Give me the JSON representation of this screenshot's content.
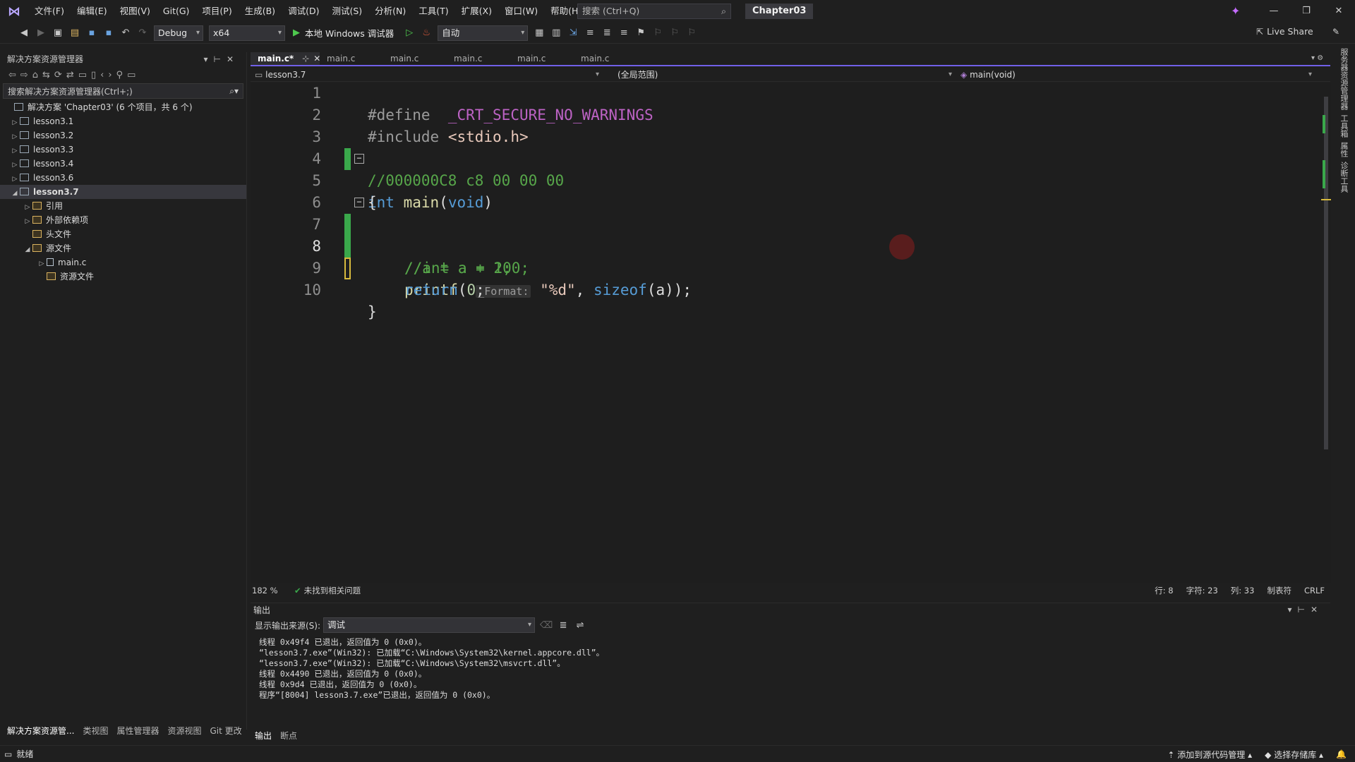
{
  "titlebar": {
    "menus": [
      "文件(F)",
      "编辑(E)",
      "视图(V)",
      "Git(G)",
      "项目(P)",
      "生成(B)",
      "调试(D)",
      "测试(S)",
      "分析(N)",
      "工具(T)",
      "扩展(X)",
      "窗口(W)",
      "帮助(H)"
    ],
    "search_placeholder": "搜索 (Ctrl+Q)",
    "solution_name": "Chapter03"
  },
  "toolbar": {
    "config": "Debug",
    "platform": "x64",
    "run_label": "本地 Windows 调试器",
    "auto_label": "自动",
    "live_share": "Live Share"
  },
  "solution_explorer": {
    "title": "解决方案资源管理器",
    "search_placeholder": "搜索解决方案资源管理器(Ctrl+;)",
    "solution_label": "解决方案 'Chapter03' (6 个项目，共 6 个)",
    "projects": [
      "lesson3.1",
      "lesson3.2",
      "lesson3.3",
      "lesson3.4",
      "lesson3.6",
      "lesson3.7"
    ],
    "children": [
      "引用",
      "外部依赖项",
      "头文件",
      "源文件"
    ],
    "source_file": "main.c",
    "resource_folder": "资源文件"
  },
  "editor": {
    "tabs": [
      "main.c*",
      "main.c",
      "main.c",
      "main.c",
      "main.c",
      "main.c"
    ],
    "nav_project": "lesson3.7",
    "nav_scope": "(全局范围)",
    "nav_member": "main(void)",
    "line_numbers": [
      "1",
      "2",
      "3",
      "4",
      "5",
      "6",
      "7",
      "8",
      "9",
      "10"
    ],
    "lines": {
      "l1_a": "#define",
      "l1_b": "_CRT_SECURE_NO_WARNINGS",
      "l2_a": "#include",
      "l2_b": "<stdio.h>",
      "l3": "//000000C8 c8 00 00 00",
      "l4_a": "int",
      "l4_b": "main",
      "l4_c": "(",
      "l4_d": "void",
      "l4_e": ")",
      "l5": "{",
      "l6": "//int a = 200;",
      "l7": "//a = a + 1;",
      "l8_fn": "printf",
      "l8_hint": "_Format:",
      "l8_str": "\"%d\"",
      "l8_sizeof": "sizeof",
      "l8_rest": "(a));",
      "l9_kw": "return",
      "l9_num": "0",
      "l10": "}"
    }
  },
  "statusline": {
    "zoom": "182 %",
    "issues": "未找到相关问题",
    "row": "行: 8",
    "char": "字符: 23",
    "col": "列: 33",
    "tab": "制表符",
    "eol": "CRLF"
  },
  "output": {
    "title": "输出",
    "source_label": "显示输出来源(S):",
    "source_value": "调试",
    "lines": [
      "线程 0x49f4 已退出，返回值为 0 (0x0)。",
      "“lesson3.7.exe”(Win32): 已加载“C:\\Windows\\System32\\kernel.appcore.dll”。",
      "“lesson3.7.exe”(Win32): 已加载“C:\\Windows\\System32\\msvcrt.dll”。",
      "线程 0x4490 已退出，返回值为 0 (0x0)。",
      "线程 0x9d4 已退出，返回值为 0 (0x0)。",
      "程序“[8004] lesson3.7.exe”已退出，返回值为 0 (0x0)。"
    ]
  },
  "bottom_tabs_left": [
    "解决方案资源管...",
    "类视图",
    "属性管理器",
    "资源视图",
    "Git 更改"
  ],
  "bottom_tabs_right": [
    "输出",
    "断点"
  ],
  "statusbar": {
    "ready": "就绪",
    "add_source": "添加到源代码管理",
    "select_repo": "选择存储库"
  },
  "right_rail": [
    "服务器资源管理器",
    "工具箱",
    "属性",
    "诊断工具"
  ]
}
